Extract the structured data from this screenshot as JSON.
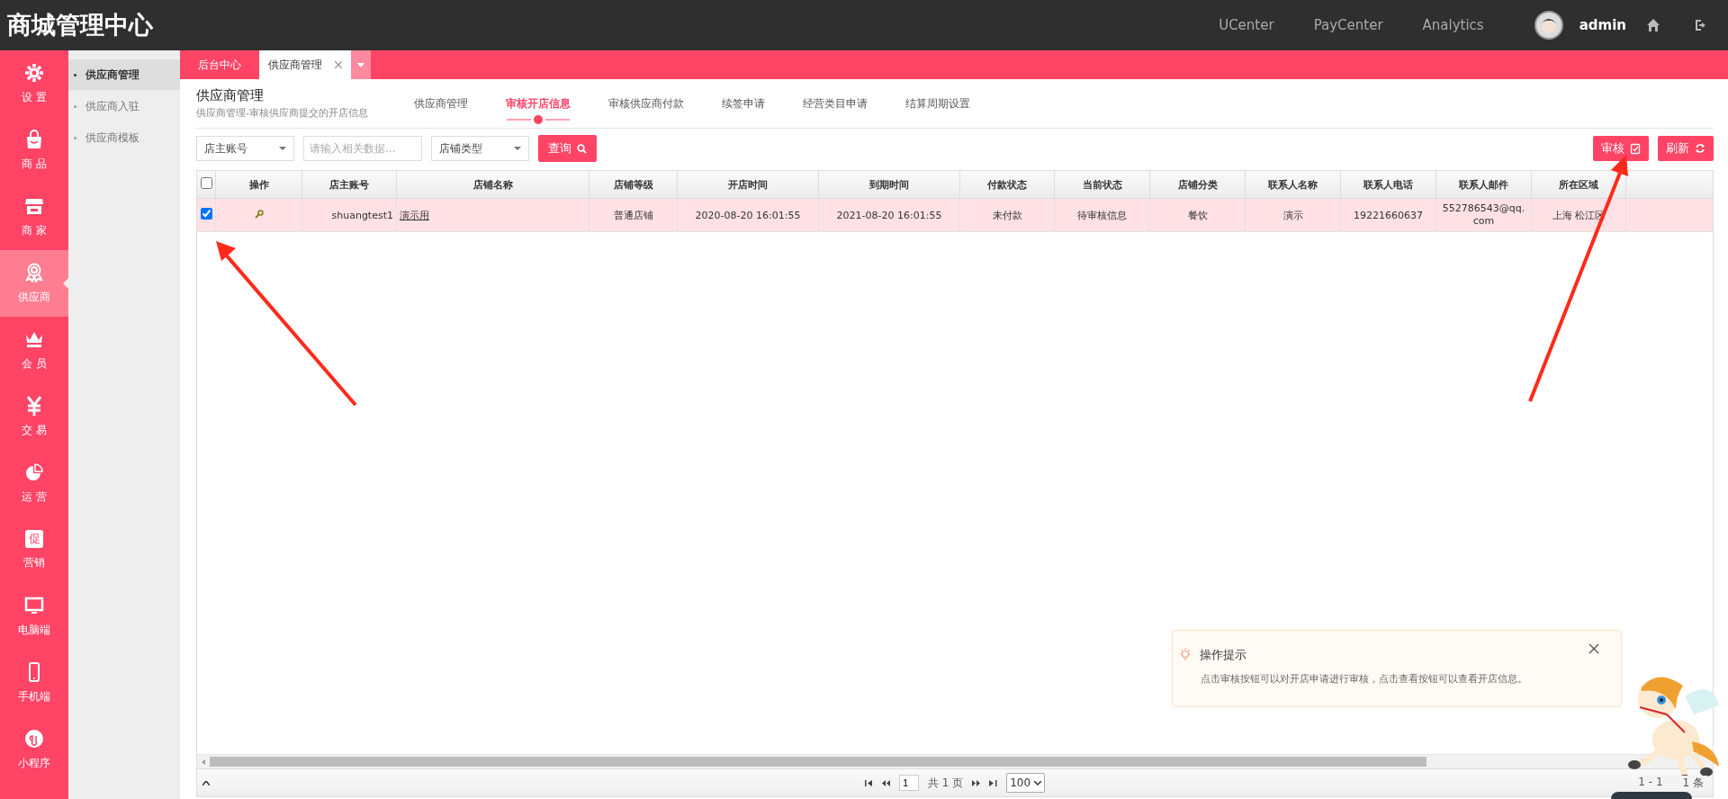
{
  "app": {
    "title": "商城管理中心"
  },
  "top_nav": {
    "links": [
      "UCenter",
      "PayCenter",
      "Analytics"
    ],
    "user": "admin"
  },
  "sidebar": {
    "items": [
      {
        "label": "设 置",
        "selected": false
      },
      {
        "label": "商 品",
        "selected": false
      },
      {
        "label": "商 家",
        "selected": false
      },
      {
        "label": "供应商",
        "selected": true
      },
      {
        "label": "会 员",
        "selected": false
      },
      {
        "label": "交 易",
        "selected": false
      },
      {
        "label": "运 营",
        "selected": false
      },
      {
        "label": "营销",
        "selected": false,
        "icon_text": "促"
      },
      {
        "label": "电脑端",
        "selected": false
      },
      {
        "label": "手机端",
        "selected": false
      },
      {
        "label": "小程序",
        "selected": false
      }
    ]
  },
  "submenu": {
    "items": [
      {
        "label": "供应商管理",
        "selected": true
      },
      {
        "label": "供应商入驻",
        "selected": false
      },
      {
        "label": "供应商模板",
        "selected": false
      }
    ]
  },
  "tabs": [
    {
      "label": "后台中心",
      "selected": false,
      "closable": false
    },
    {
      "label": "供应商管理",
      "selected": true,
      "closable": true
    }
  ],
  "page": {
    "title": "供应商管理",
    "subtitle": "供应商管理-审核供应商提交的开店信息"
  },
  "sub_tabs": [
    {
      "label": "供应商管理",
      "selected": false
    },
    {
      "label": "审核开店信息",
      "selected": true
    },
    {
      "label": "审核供应商付款",
      "selected": false
    },
    {
      "label": "续签申请",
      "selected": false
    },
    {
      "label": "经营类目申请",
      "selected": false
    },
    {
      "label": "结算周期设置",
      "selected": false
    }
  ],
  "filters": {
    "field_select": "店主账号",
    "search_placeholder": "请输入相关数据...",
    "type_select": "店铺类型",
    "search_button": "查询"
  },
  "actions": [
    "审核",
    "刷新"
  ],
  "table": {
    "all_selected": false,
    "columns": [
      "操作",
      "店主账号",
      "店铺名称",
      "店铺等级",
      "开店时间",
      "到期时间",
      "付款状态",
      "当前状态",
      "店铺分类",
      "联系人名称",
      "联系人电话",
      "联系人邮件",
      "所在区域"
    ],
    "rows": [
      {
        "selected": true,
        "account": "shuangtest1",
        "store_name": "演示用",
        "level": "普通店铺",
        "open_time": "2020-08-20 16:01:55",
        "expire_time": "2021-08-20 16:01:55",
        "payment_status": "未付款",
        "current_status": "待审核信息",
        "category": "餐饮",
        "contact_name": "演示",
        "contact_phone": "19221660637",
        "contact_email": "552786543@qq.com",
        "region": "上海 松江区"
      }
    ]
  },
  "pager": {
    "page": "1",
    "total_pages": "共 1 页",
    "page_size": "100",
    "range": "1 - 1",
    "count": "1 条"
  },
  "tip": {
    "title": "操作提示",
    "text": "点击审核按钮可以对开店申请进行审核，点击查看按钮可以查看开店信息。"
  }
}
